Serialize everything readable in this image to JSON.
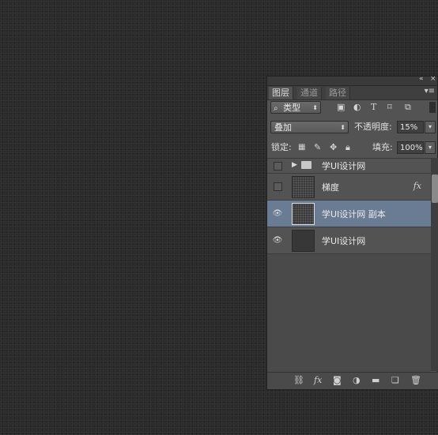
{
  "panel": {
    "collapse_label": "«",
    "close_label": "×",
    "menu_label": "▾≡",
    "tabs": [
      {
        "label": "图层",
        "active": true
      },
      {
        "label": "通道",
        "active": false
      },
      {
        "label": "路径",
        "active": false
      }
    ]
  },
  "filter": {
    "kind_label": "类型",
    "search_glyph": "⌕",
    "icons": [
      "image-filter-icon",
      "adjustment-filter-icon",
      "type-filter-icon",
      "shape-filter-icon",
      "smart-object-filter-icon"
    ]
  },
  "blend": {
    "mode": "叠加",
    "opacity_label": "不透明度:",
    "opacity_value": "15%"
  },
  "lock": {
    "label": "锁定:",
    "fill_label": "填充:",
    "fill_value": "100%"
  },
  "layers": {
    "group_name": "学UI设计网",
    "items": [
      {
        "name": "梯度",
        "visible": false,
        "selected": false,
        "fx": "fx",
        "thumb": "texture"
      },
      {
        "name": "学UI设计网 副本",
        "visible": true,
        "selected": true,
        "fx": "",
        "thumb": "texture"
      },
      {
        "name": "学UI设计网",
        "visible": true,
        "selected": false,
        "fx": "",
        "thumb": "plain"
      }
    ]
  },
  "bottom": {
    "fx_label": "fx"
  },
  "colors": {
    "canvas": "#2a2a2a",
    "panel": "#535353",
    "selected_layer": "#6a7c93"
  }
}
